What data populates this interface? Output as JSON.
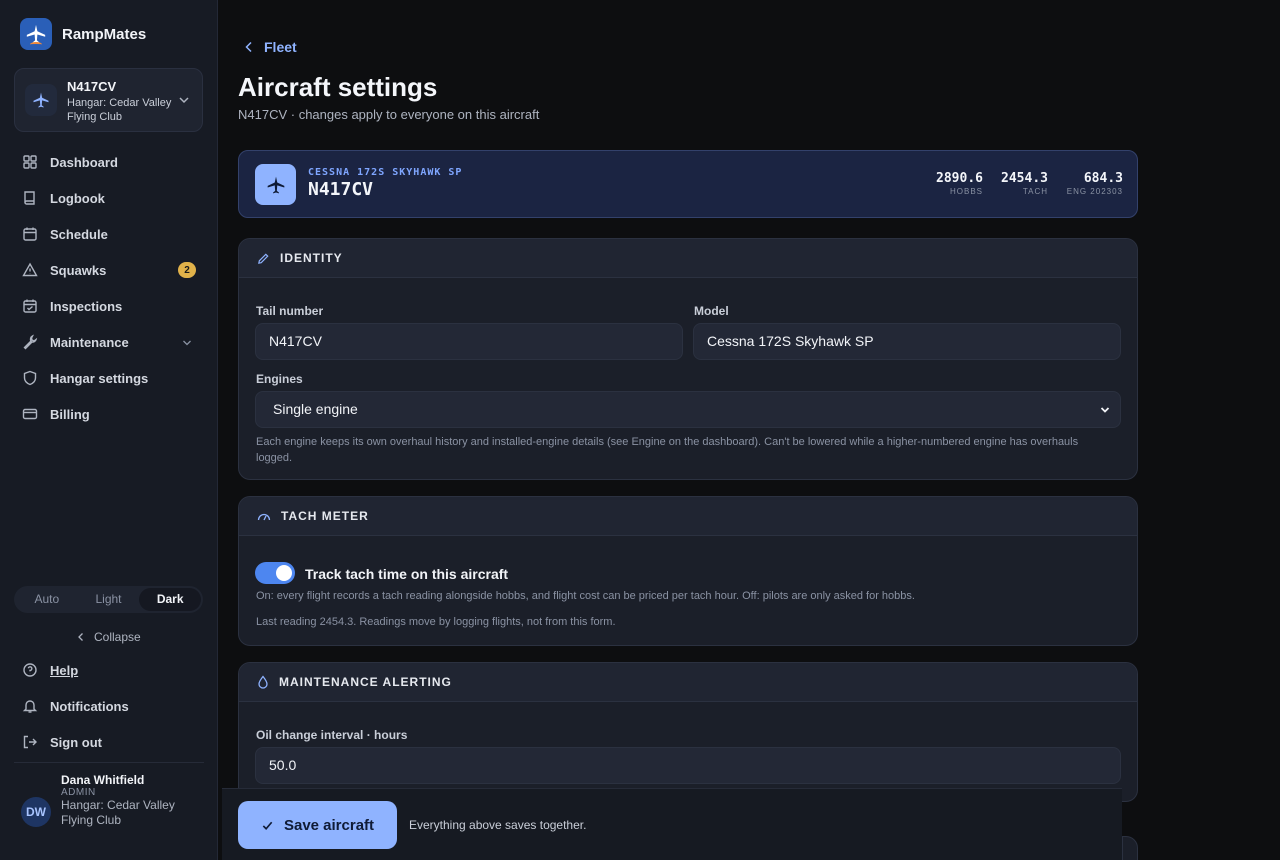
{
  "app": {
    "name": "RampMates"
  },
  "aircraft_switcher": {
    "tail": "N417CV",
    "hangar": "Hangar: Cedar Valley Flying Club"
  },
  "nav": {
    "items": [
      {
        "label": "Dashboard",
        "icon": "dashboard-icon"
      },
      {
        "label": "Logbook",
        "icon": "book-icon"
      },
      {
        "label": "Schedule",
        "icon": "calendar-icon"
      },
      {
        "label": "Squawks",
        "icon": "warning-icon",
        "badge": "2"
      },
      {
        "label": "Inspections",
        "icon": "calendar-check-icon"
      },
      {
        "label": "Maintenance",
        "icon": "wrench-icon"
      },
      {
        "label": "Hangar settings",
        "icon": "shield-icon"
      },
      {
        "label": "Billing",
        "icon": "card-icon"
      }
    ]
  },
  "theme": {
    "options": [
      "Auto",
      "Light",
      "Dark"
    ],
    "selected": "Dark"
  },
  "collapse_label": "Collapse",
  "lower_nav": {
    "help": "Help",
    "notifications": "Notifications",
    "sign_out": "Sign out"
  },
  "user": {
    "initials": "DW",
    "name": "Dana Whitfield",
    "role": "ADMIN",
    "hangar": "Hangar: Cedar Valley Flying Club"
  },
  "page": {
    "back_label": "Fleet",
    "title": "Aircraft settings",
    "subtitle": "N417CV · changes apply to everyone on this aircraft"
  },
  "hero": {
    "model": "CESSNA 172S SKYHAWK SP",
    "tail": "N417CV",
    "stats": [
      {
        "value": "2890.6",
        "label": "HOBBS"
      },
      {
        "value": "2454.3",
        "label": "TACH"
      },
      {
        "value": "684.3",
        "label": "ENG 202303"
      }
    ]
  },
  "identity": {
    "heading": "IDENTITY",
    "tail_label": "Tail number",
    "tail_value": "N417CV",
    "model_label": "Model",
    "model_value": "Cessna 172S Skyhawk SP",
    "engines_label": "Engines",
    "engines_value": "Single engine",
    "engines_help": "Each engine keeps its own overhaul history and installed-engine details (see Engine on the dashboard). Can't be lowered while a higher-numbered engine has overhauls logged."
  },
  "tach": {
    "heading": "TACH METER",
    "toggle_label": "Track tach time on this aircraft",
    "toggle_on": true,
    "help": "On: every flight records a tach reading alongside hobbs, and flight cost can be priced per tach hour. Off: pilots are only asked for hobbs.",
    "last_reading": "Last reading 2454.3. Readings move by logging flights, not from this form."
  },
  "maintenance": {
    "heading": "MAINTENANCE ALERTING",
    "oil_label": "Oil change interval · hours",
    "oil_value": "50.0"
  },
  "savebar": {
    "button": "Save aircraft",
    "note": "Everything above saves together."
  },
  "colors": {
    "accent": "#8fb3ff",
    "toggle": "#4d86f0",
    "badge": "#e1b24a",
    "background": "#0d0e10"
  }
}
